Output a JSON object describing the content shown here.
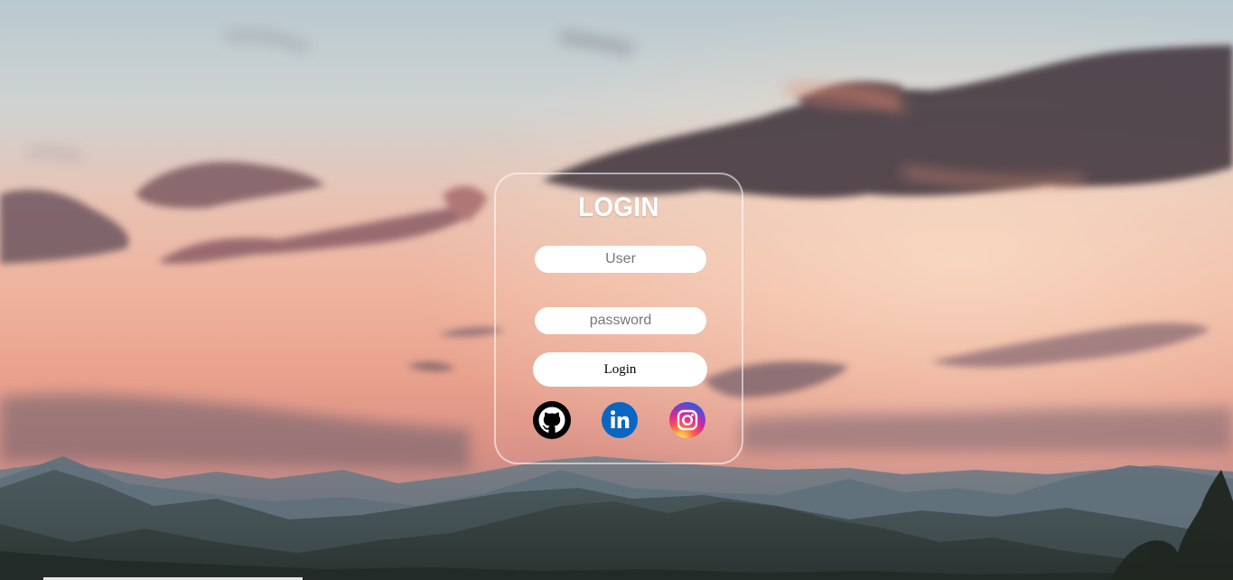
{
  "login": {
    "title": "LOGIN",
    "user_placeholder": "User",
    "password_placeholder": "password",
    "button_label": "Login"
  },
  "social_links": [
    {
      "name": "github-icon",
      "color": "#000000"
    },
    {
      "name": "linkedin-icon",
      "color": "#0A66C2"
    },
    {
      "name": "instagram-icon",
      "color": "#E1306C"
    }
  ],
  "colors": {
    "card_border": "rgba(255,255,255,0.55)",
    "input_background": "#ffffff",
    "title_color": "#ffffff"
  }
}
